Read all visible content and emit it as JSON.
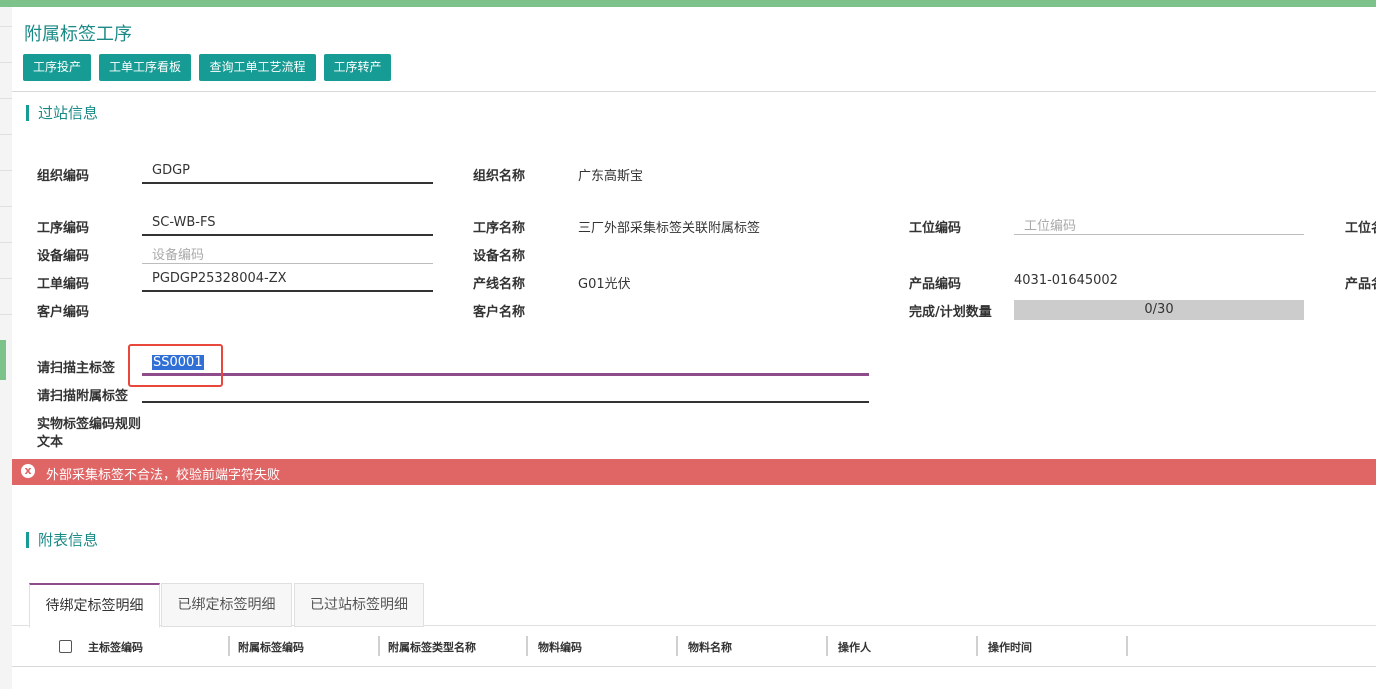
{
  "page": {
    "title": "附属标签工序",
    "buttons": [
      {
        "label": "工序投产"
      },
      {
        "label": "工单工序看板"
      },
      {
        "label": "查询工单工艺流程"
      },
      {
        "label": "工序转产"
      }
    ]
  },
  "station_section": {
    "title": "过站信息",
    "org_code": {
      "label": "组织编码",
      "value": "GDGP"
    },
    "org_name": {
      "label": "组织名称",
      "value": "广东高斯宝"
    },
    "process_code": {
      "label": "工序编码",
      "value": "SC-WB-FS"
    },
    "process_name": {
      "label": "工序名称",
      "value": "三厂外部采集标签关联附属标签"
    },
    "workstation_code": {
      "label": "工位编码",
      "placeholder": "工位编码"
    },
    "workstation_name_cut": {
      "label": "工位名"
    },
    "device_code": {
      "label": "设备编码",
      "placeholder": "设备编码"
    },
    "device_name": {
      "label": "设备名称"
    },
    "work_order": {
      "label": "工单编码",
      "value": "PGDGP25328004-ZX"
    },
    "line_name": {
      "label": "产线名称",
      "value": "G01光伏"
    },
    "product_code": {
      "label": "产品编码",
      "value": "4031-01645002"
    },
    "product_name_cut": {
      "label": "产品名"
    },
    "customer_code": {
      "label": "客户编码"
    },
    "customer_name": {
      "label": "客户名称"
    },
    "progress": {
      "label": "完成/计划数量",
      "text": "0/30",
      "done": 0,
      "plan": 30
    },
    "scan_main": {
      "label": "请扫描主标签",
      "value": "SS0001"
    },
    "scan_sub": {
      "label": "请扫描附属标签"
    },
    "rule_text": {
      "label_line1": "实物标签编码规则",
      "label_line2": "文本"
    }
  },
  "error": {
    "icon": "x",
    "message": "外部采集标签不合法，校验前端字符失败"
  },
  "attach_section": {
    "title": "附表信息",
    "tabs": [
      {
        "label": "待绑定标签明细",
        "active": true
      },
      {
        "label": "已绑定标签明细",
        "active": false
      },
      {
        "label": "已过站标签明细",
        "active": false
      }
    ],
    "columns": [
      "主标签编码",
      "附属标签编码",
      "附属标签类型名称",
      "物料编码",
      "物料名称",
      "操作人",
      "操作时间"
    ]
  },
  "colors": {
    "accent": "#169c94",
    "error": "#e06666",
    "focus": "#8e4d8a",
    "highlight": "#e8473c"
  }
}
